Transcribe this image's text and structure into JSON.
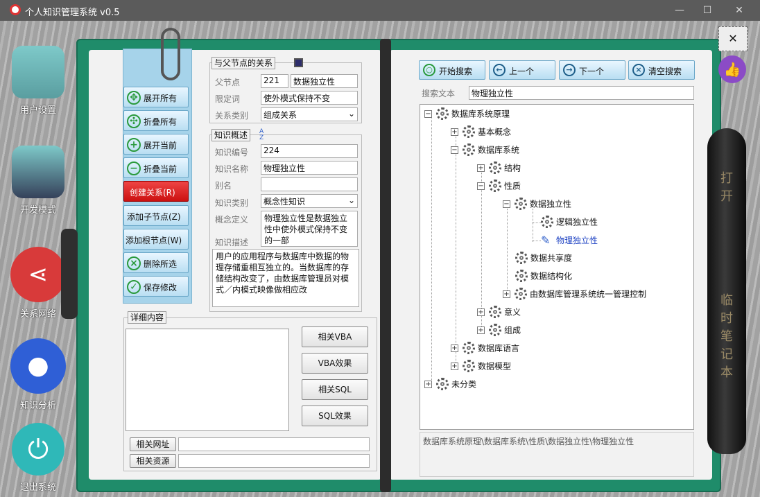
{
  "window": {
    "title": "个人知识管理系统 v0.5",
    "minimize": "—",
    "maximize": "☐",
    "close": "✕"
  },
  "sidebar": [
    {
      "label": "用户设置",
      "icon": "user-settings-icon"
    },
    {
      "label": "开发模式",
      "icon": "developer-icon"
    },
    {
      "label": "关系网络",
      "icon": "share-icon"
    },
    {
      "label": "知识分析",
      "icon": "lightbulb-icon"
    },
    {
      "label": "退出系统",
      "icon": "power-icon"
    }
  ],
  "actions": {
    "expand_all": "展开所有",
    "collapse_all": "折叠所有",
    "expand_current": "展开当前",
    "collapse_current": "折叠当前",
    "create_relation": "创建关系(R)",
    "add_child": "添加子节点(Z)",
    "add_root": "添加根节点(W)",
    "delete_selected": "删除所选",
    "save_changes": "保存修改"
  },
  "parent_group": {
    "title": "与父节点的关系",
    "parent_label": "父节点",
    "parent_id": "221",
    "parent_name": "数据独立性",
    "qualifier_label": "限定词",
    "qualifier_value": "使外模式保持不变",
    "relation_label": "关系类别",
    "relation_value": "组成关系"
  },
  "knowledge_group": {
    "title": "知识概述",
    "id_label": "知识编号",
    "id_value": "224",
    "name_label": "知识名称",
    "name_value": "物理独立性",
    "alias_label": "别名",
    "alias_value": "",
    "category_label": "知识类别",
    "category_value": "概念性知识",
    "definition_label": "概念定义",
    "definition_value": "物理独立性是数据独立性中使外模式保持不变的一部",
    "description_label": "知识描述",
    "description_value": "用户的应用程序与数据库中数据的物理存储重相互独立的。当数据库的存储结构改变了，由数据库管理员对模式／内模式映像做相应改"
  },
  "detail_group": {
    "title": "详细内容",
    "related_vba": "相关VBA",
    "vba_effect": "VBA效果",
    "related_sql": "相关SQL",
    "sql_effect": "SQL效果",
    "related_url_label": "相关网址",
    "related_url_value": "",
    "related_res_label": "相关资源",
    "related_res_value": ""
  },
  "search": {
    "start": "开始搜索",
    "prev": "上一个",
    "next": "下一个",
    "clear": "清空搜索",
    "label": "搜索文本",
    "value": "物理独立性"
  },
  "tree": [
    {
      "text": "数据库系统原理",
      "exp": "−"
    },
    {
      "text": "基本概念",
      "exp": "+"
    },
    {
      "text": "数据库系统",
      "exp": "−"
    },
    {
      "text": "结构",
      "exp": "+"
    },
    {
      "text": "性质",
      "exp": "−"
    },
    {
      "text": "数据独立性",
      "exp": "−"
    },
    {
      "text": "逻辑独立性",
      "exp": ""
    },
    {
      "text": "物理独立性",
      "exp": ""
    },
    {
      "text": "数据共享度",
      "exp": ""
    },
    {
      "text": "数据结构化",
      "exp": ""
    },
    {
      "text": "由数据库管理系统统一管理控制",
      "exp": "+"
    },
    {
      "text": "意义",
      "exp": "+"
    },
    {
      "text": "组成",
      "exp": "+"
    },
    {
      "text": "数据库语言",
      "exp": "+"
    },
    {
      "text": "数据模型",
      "exp": "+"
    },
    {
      "text": "未分类",
      "exp": "+"
    }
  ],
  "path_text": "数据库系统原理\\数据库系统\\性质\\数据独立性\\物理独立性",
  "pen_text": {
    "top": "打开",
    "bottom": "临时笔记本"
  },
  "colors": {
    "book_green": "#1f8c6a",
    "action_blue": "#a6d3ea",
    "create_red": "#d22222",
    "selected_node": "#1a3fc2"
  }
}
